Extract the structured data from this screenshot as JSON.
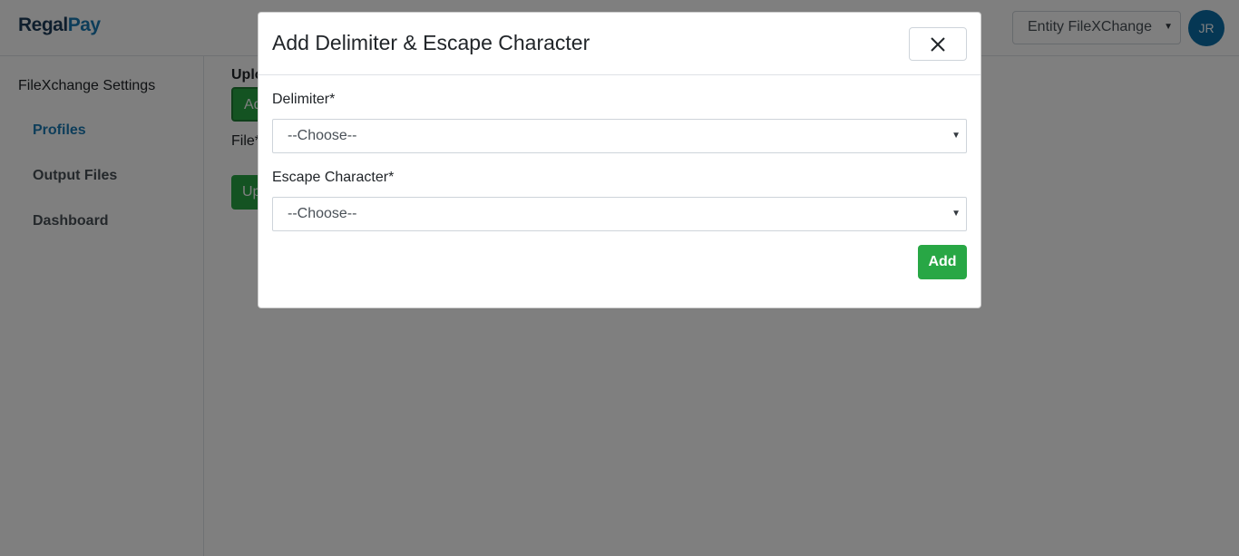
{
  "header": {
    "logo": {
      "part1": "Regal",
      "part2": "Pay"
    },
    "entity_select": {
      "value": "Entity FileXChange"
    },
    "avatar_initials": "JR"
  },
  "sidebar": {
    "title": "FileXchange Settings",
    "items": [
      {
        "label": "Profiles",
        "active": true
      },
      {
        "label": "Output Files",
        "active": false
      },
      {
        "label": "Dashboard",
        "active": false
      }
    ]
  },
  "main": {
    "heading": "Uplo",
    "top_button_label": "Ad",
    "file_label": "File*",
    "bottom_button_label": "Up"
  },
  "modal": {
    "title": "Add Delimiter & Escape Character",
    "close_icon": "close-icon",
    "delimiter": {
      "label": "Delimiter*",
      "value": "--Choose--"
    },
    "escape_character": {
      "label": "Escape Character*",
      "value": "--Choose--"
    },
    "add_button_label": "Add"
  },
  "colors": {
    "brand_blue": "#1b7bb5",
    "brand_dark": "#1d3c5a",
    "success_green": "#28a745",
    "avatar_bg": "#0a6fa8",
    "backdrop": "rgba(0,0,0,0.5)"
  }
}
